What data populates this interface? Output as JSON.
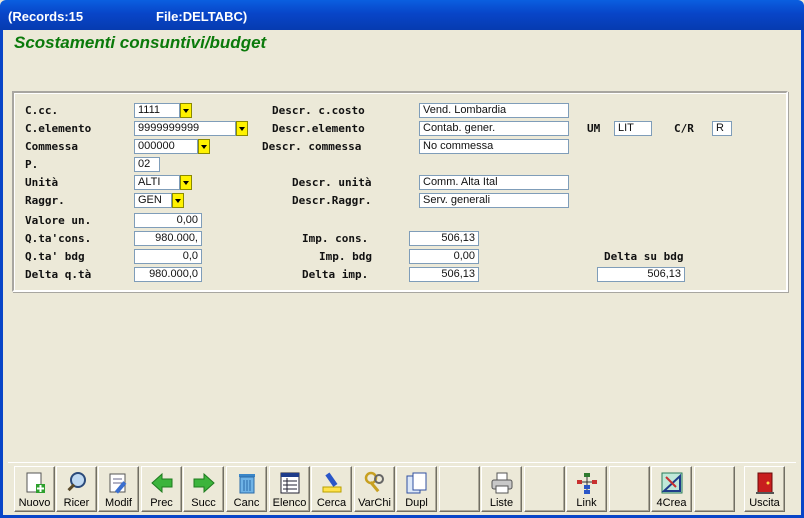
{
  "window": {
    "records": "(Records:15",
    "file": "File:DELTABC)"
  },
  "form_title": "Scostamenti consuntivi/budget",
  "labels": {
    "ccc": "C.cc.",
    "celemento": "C.elemento",
    "commessa": "Commessa",
    "p": "P.",
    "unita": "Unità",
    "raggr": "Raggr.",
    "valore_un": "Valore un.",
    "qta_cons": "Q.ta'cons.",
    "qta_bdg": "Q.ta' bdg",
    "delta_qta": "Delta q.tà",
    "descr_ccosto": "Descr. c.costo",
    "descr_elemento": "Descr.elemento",
    "descr_commessa": "Descr. commessa",
    "descr_unita": "Descr. unità",
    "descr_raggr": "Descr.Raggr.",
    "imp_cons": "Imp. cons.",
    "imp_bdg": "Imp. bdg",
    "delta_imp": "Delta imp.",
    "delta_su_bdg": "Delta su bdg",
    "um": "UM",
    "cr": "C/R"
  },
  "values": {
    "ccc": "1111",
    "celemento": "9999999999",
    "commessa": "000000",
    "p": "02",
    "unita": "ALTI",
    "raggr": "GEN",
    "valore_un": "0,00",
    "qta_cons": "980.000,",
    "qta_bdg": "0,0",
    "delta_qta": "980.000,0",
    "descr_ccosto": "Vend. Lombardia",
    "descr_elemento": "Contab. gener.",
    "descr_commessa": "No commessa",
    "descr_unita": "Comm. Alta Ital",
    "descr_raggr": "Serv. generali",
    "imp_cons": "506,13",
    "imp_bdg": "0,00",
    "delta_imp": "506,13",
    "delta_su_bdg": "506,13",
    "um": "LIT",
    "cr": "R"
  },
  "toolbar": [
    {
      "label": "Nuovo",
      "icon": "new-document-icon"
    },
    {
      "label": "Ricer",
      "icon": "search-icon"
    },
    {
      "label": "Modif",
      "icon": "edit-icon"
    },
    {
      "label": "Prec",
      "icon": "arrow-left-icon"
    },
    {
      "label": "Succ",
      "icon": "arrow-right-icon"
    },
    {
      "label": "Canc",
      "icon": "trash-icon"
    },
    {
      "label": "Elenco",
      "icon": "list-icon"
    },
    {
      "label": "Cerca",
      "icon": "highlighter-icon"
    },
    {
      "label": "VarChi",
      "icon": "keys-icon"
    },
    {
      "label": "Dupl",
      "icon": "duplicate-icon"
    },
    {
      "label": "",
      "icon": ""
    },
    {
      "label": "Liste",
      "icon": "printer-icon"
    },
    {
      "label": "",
      "icon": ""
    },
    {
      "label": "Link",
      "icon": "tree-icon"
    },
    {
      "label": "",
      "icon": ""
    },
    {
      "label": "4Crea",
      "icon": "drafting-icon"
    },
    {
      "label": "",
      "icon": ""
    },
    {
      "label": "Uscita",
      "icon": "exit-door-icon"
    }
  ]
}
